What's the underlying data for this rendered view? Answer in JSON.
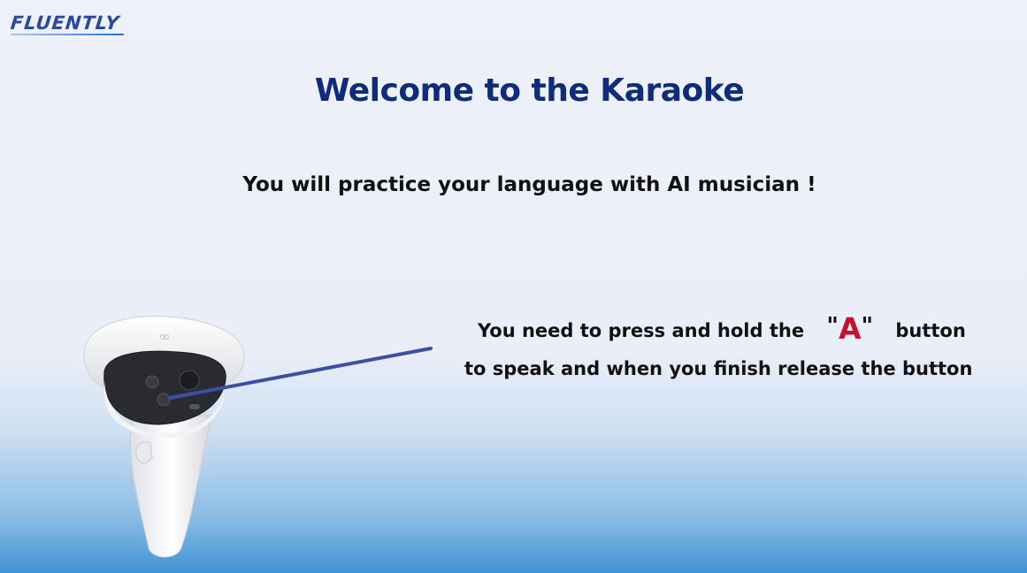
{
  "brand": {
    "logo_text": "FLUENTLY"
  },
  "title": "Welcome to the Karaoke",
  "subtitle": "You will practice your language with AI musician !",
  "instruction": {
    "line1_before": "You need to press and hold the",
    "button_open_quote": "\"",
    "button_label": "A",
    "button_close_quote": "\"",
    "line1_after": "button",
    "line2": "to speak and when you finish release the button"
  },
  "colors": {
    "title": "#0f2b7c",
    "button_highlight": "#c41230",
    "pointer_line": "#3d4fa3"
  },
  "icons": {
    "controller": "vr-controller-icon",
    "logo": "fluently-logo"
  }
}
